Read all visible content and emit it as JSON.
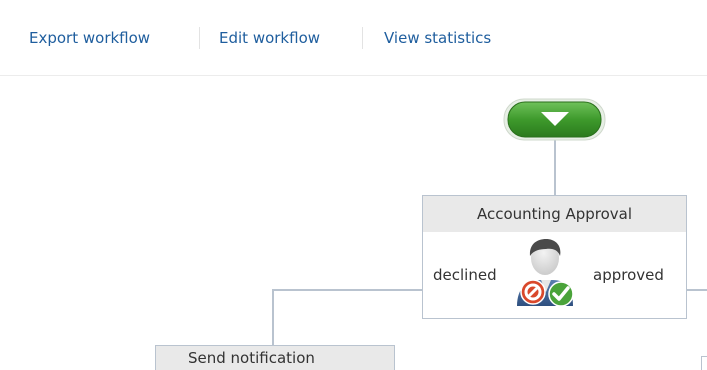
{
  "toolbar": {
    "export_label": "Export workflow",
    "edit_label": "Edit workflow",
    "stats_label": "View statistics"
  },
  "workflow": {
    "start_node": {
      "icon": "start-triangle-icon"
    },
    "approval_step": {
      "title": "Accounting Approval",
      "left_branch": "declined",
      "right_branch": "approved",
      "icon": "user-approval-icon"
    },
    "notification_step": {
      "title": "Send notification"
    }
  },
  "colors": {
    "link": "#1f5e9e",
    "start_green": "#3c8f2a",
    "connector": "#b9c3cf",
    "header_bg": "#e9e9e9"
  }
}
